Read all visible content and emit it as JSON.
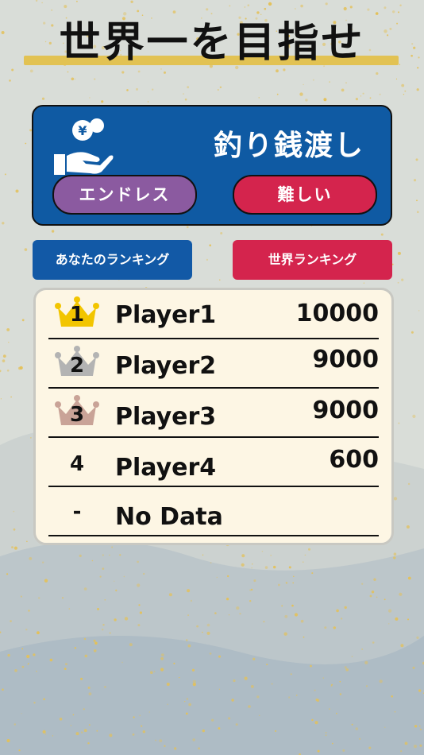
{
  "title": "世界一を目指せ",
  "mode_card": {
    "game_title": "釣り銭渡し",
    "mode_button": "エンドレス",
    "difficulty_button": "難しい"
  },
  "ranking_tabs": {
    "yours": "あなたのランキング",
    "world": "世界ランキング"
  },
  "colors": {
    "card_blue": "#0f5aa3",
    "purple": "#8b5aa0",
    "crimson": "#d4244d",
    "gold": "#f2c500",
    "silver": "#b3b3b3",
    "bronze": "#c9a397",
    "board_bg": "#fdf6e4"
  },
  "ranking": [
    {
      "rank": "1",
      "name": "Player1",
      "score": "10000",
      "crown": "gold-crown-icon"
    },
    {
      "rank": "2",
      "name": "Player2",
      "score": "9000",
      "crown": "silver-crown-icon"
    },
    {
      "rank": "3",
      "name": "Player3",
      "score": "9000",
      "crown": "bronze-crown-icon"
    },
    {
      "rank": "4",
      "name": "Player4",
      "score": "600",
      "crown": ""
    },
    {
      "rank": "-",
      "name": "No Data",
      "score": "",
      "crown": ""
    }
  ]
}
